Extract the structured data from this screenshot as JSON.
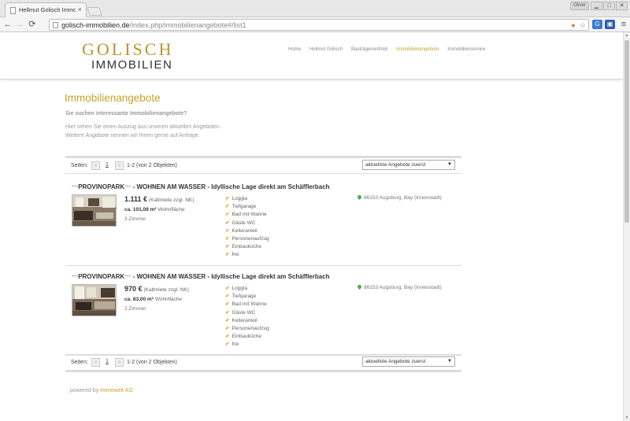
{
  "browser": {
    "tab_title": "Hellmut Golisch Immobilie",
    "tab_close": "×",
    "user_badge": "Oliver",
    "win_min": "▁",
    "win_max": "□",
    "win_close": "✕",
    "url_domain": "golisch-immobilien.de",
    "url_rest": "/index.php/immobilienangebote#/list1",
    "back": "←",
    "forward": "→",
    "reload": "⟳",
    "menu": "≡"
  },
  "header": {
    "logo_top": "GOLISCH",
    "logo_bottom": "IMMOBILIEN",
    "nav": [
      "Home",
      "Hellmut Golisch",
      "Bauträgervertrieb",
      "Immobilienangebote",
      "Immobilienservice"
    ],
    "active_nav": "Immobilienangebote"
  },
  "main": {
    "title": "Immobilienangebote",
    "question": "Sie suchen interessante Immobilienangebote?",
    "intro_1": "Hier sehen Sie einen Auszug aus unseren aktuellen Angeboten.",
    "intro_2": "Weitere Angebote nennen wir Ihnen gerne auf Anfrage."
  },
  "pager": {
    "label": "Seiten:",
    "prev": "«",
    "current_page": "1",
    "next": "»",
    "count": "1-2 (von 2 Objekten)",
    "sort_value": "aktuellste Angebote zuerst",
    "sort_arrow": "▼"
  },
  "listings": [
    {
      "stars_prefix": "***",
      "title_name": "PROVINOPARK",
      "stars_suffix": "***",
      "title_rest": " - WOHNEN AM WASSER - Idyllische Lage direkt am Schäfflerbach",
      "price": "1.111 €",
      "price_note": "(Kaltmiete zzgl. NK)",
      "area": "ca. 101,08 m²",
      "area_label": "Wohnfläche",
      "rooms": "3 Zimmer",
      "features": [
        "Loggia",
        "Tiefgarage",
        "Bad mit Wanne",
        "Gäste WC",
        "Kelleranteil",
        "Personenaufzug",
        "Einbauküche",
        "frei"
      ],
      "location": "86153 Augsburg, Bay (Innenstadt)"
    },
    {
      "stars_prefix": "***",
      "title_name": "PROVINOPARK",
      "stars_suffix": "***",
      "title_rest": " - WOHNEN AM WASSER - Idyllische Lage direkt am Schäfflerbach",
      "price": "970 €",
      "price_note": "(Kaltmiete zzgl. NK)",
      "area": "ca. 83,00 m²",
      "area_label": "Wohnfläche",
      "rooms": "3 Zimmer",
      "features": [
        "Loggia",
        "Tiefgarage",
        "Bad mit Wanne",
        "Gäste WC",
        "Kelleranteil",
        "Personenaufzug",
        "Einbauküche",
        "frei"
      ],
      "location": "86153 Augsburg, Bay (Innenstadt)"
    }
  ],
  "footer": {
    "powered_by": "powered by",
    "brand": "Immowelt AG"
  },
  "colors": {
    "accent_gold": "#c9a12a",
    "logo_gold": "#b8962e",
    "tick": "#d9a520",
    "pin": "#4caf50"
  }
}
